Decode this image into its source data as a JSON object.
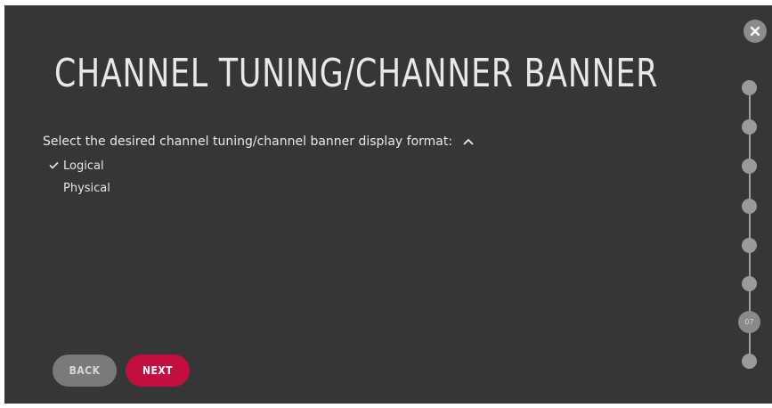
{
  "title": "CHANNEL TUNING/CHANNER BANNER",
  "prompt": "Select the desired channel tuning/channel banner display format:",
  "options": [
    {
      "label": "Logical",
      "selected": true
    },
    {
      "label": "Physical",
      "selected": false
    }
  ],
  "buttons": {
    "back": "BACK",
    "next": "NEXT"
  },
  "steps": {
    "current_label": "07",
    "current_index": 7,
    "total": 8
  },
  "icons": {
    "close": "close-icon",
    "caret": "chevron-up-icon",
    "check": "checkmark-icon"
  },
  "colors": {
    "background": "#363636",
    "accent": "#c20f3f",
    "back_button": "#7a7a7a",
    "step_dot": "#9a9a9a"
  }
}
